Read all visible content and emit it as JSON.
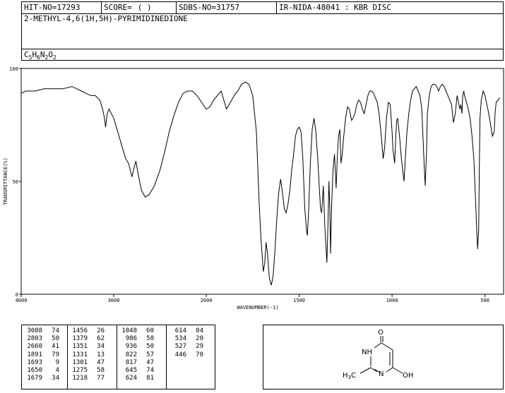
{
  "header": {
    "hit_no": "HIT-NO=17293",
    "score_label": "SCORE=",
    "score_value": "(    )",
    "sdbs_no": "SDBS-NO=31757",
    "ir_info": "IR-NIDA-48041 : KBR DISC",
    "compound_name": "2-METHYL-4,6(1H,5H)-PYRIMIDINEDIONE",
    "formula": {
      "c": "C",
      "c_n": "5",
      "h": "H",
      "h_n": "6",
      "n": "N",
      "n_n": "2",
      "o": "O",
      "o_n": "2"
    }
  },
  "chart_data": {
    "type": "line",
    "xlabel": "WAVENUMBER(-1)",
    "ylabel": "TRANSMITTANCE(%)",
    "x_ticks": [
      "4000",
      "3000",
      "2000",
      "1500",
      "1000",
      "500"
    ],
    "y_ticks": [
      "100",
      "50",
      "0"
    ],
    "xlim": [
      4000,
      400
    ],
    "ylim": [
      0,
      100
    ],
    "x_axis": "piecewise: 4000-2000 compressed, 2000-400 expanded",
    "grid": false,
    "x": [
      4000,
      3950,
      3850,
      3750,
      3650,
      3550,
      3450,
      3400,
      3350,
      3300,
      3250,
      3200,
      3150,
      3120,
      3100,
      3088,
      3070,
      3050,
      3000,
      2950,
      2900,
      2870,
      2840,
      2803,
      2780,
      2760,
      2740,
      2700,
      2660,
      2620,
      2560,
      2500,
      2450,
      2400,
      2350,
      2300,
      2250,
      2200,
      2150,
      2100,
      2050,
      2000,
      1980,
      1960,
      1940,
      1920,
      1891,
      1870,
      1850,
      1830,
      1810,
      1790,
      1770,
      1750,
      1730,
      1715,
      1705,
      1693,
      1685,
      1678,
      1670,
      1665,
      1660,
      1650,
      1640,
      1630,
      1620,
      1610,
      1600,
      1590,
      1580,
      1570,
      1560,
      1550,
      1540,
      1530,
      1520,
      1510,
      1500,
      1490,
      1480,
      1470,
      1460,
      1456,
      1450,
      1440,
      1430,
      1420,
      1410,
      1400,
      1390,
      1385,
      1379,
      1370,
      1362,
      1351,
      1345,
      1340,
      1335,
      1331,
      1325,
      1318,
      1310,
      1301,
      1295,
      1288,
      1281,
      1275,
      1268,
      1260,
      1250,
      1240,
      1230,
      1218,
      1210,
      1200,
      1190,
      1180,
      1170,
      1160,
      1150,
      1140,
      1130,
      1120,
      1110,
      1100,
      1090,
      1080,
      1070,
      1060,
      1048,
      1040,
      1030,
      1020,
      1010,
      1000,
      995,
      986,
      980,
      975,
      970,
      960,
      950,
      936,
      930,
      920,
      910,
      900,
      890,
      880,
      870,
      860,
      850,
      840,
      830,
      822,
      815,
      810,
      800,
      790,
      780,
      770,
      760,
      750,
      740,
      730,
      720,
      710,
      700,
      690,
      680,
      670,
      660,
      650,
      645,
      640,
      635,
      630,
      624,
      620,
      614,
      610,
      600,
      590,
      580,
      570,
      560,
      550,
      545,
      540,
      534,
      530,
      527,
      520,
      510,
      500,
      490,
      480,
      470,
      460,
      450,
      446,
      440,
      430,
      420,
      400
    ],
    "values": [
      89,
      90,
      90,
      91,
      91,
      91,
      92,
      91,
      90,
      89,
      88,
      88,
      86,
      82,
      78,
      74,
      80,
      82,
      78,
      71,
      64,
      60,
      58,
      52,
      56,
      59,
      54,
      46,
      43,
      44,
      48,
      55,
      63,
      72,
      79,
      85,
      89,
      90,
      90,
      88,
      85,
      82,
      83,
      86,
      88,
      90,
      82,
      85,
      88,
      90,
      93,
      94,
      93,
      88,
      72,
      40,
      24,
      10,
      14,
      23,
      18,
      12,
      7,
      4,
      8,
      20,
      34,
      45,
      51,
      45,
      38,
      36,
      40,
      46,
      55,
      62,
      70,
      73,
      74,
      72,
      60,
      38,
      28,
      26,
      35,
      58,
      73,
      78,
      72,
      60,
      45,
      38,
      36,
      48,
      30,
      14,
      30,
      50,
      38,
      18,
      40,
      55,
      62,
      47,
      60,
      70,
      73,
      58,
      62,
      70,
      78,
      83,
      82,
      77,
      78,
      80,
      84,
      86,
      85,
      82,
      80,
      84,
      88,
      90,
      90,
      89,
      87,
      85,
      80,
      72,
      60,
      65,
      78,
      85,
      84,
      72,
      64,
      58,
      70,
      77,
      78,
      70,
      60,
      50,
      58,
      72,
      80,
      86,
      90,
      91,
      92,
      90,
      88,
      82,
      62,
      48,
      62,
      80,
      88,
      92,
      93,
      93,
      92,
      90,
      92,
      93,
      92,
      90,
      88,
      86,
      84,
      76,
      80,
      88,
      86,
      84,
      82,
      84,
      80,
      88,
      90,
      88,
      85,
      82,
      78,
      70,
      60,
      40,
      30,
      20,
      28,
      60,
      78,
      86,
      90,
      88,
      84,
      80,
      75,
      70,
      72,
      80,
      85,
      86,
      87
    ]
  },
  "peaks": [
    [
      [
        "3088",
        "74"
      ],
      [
        "2803",
        "50"
      ],
      [
        "2660",
        "41"
      ],
      [
        "1891",
        "79"
      ],
      [
        "1693",
        "9"
      ],
      [
        "1650",
        "4"
      ],
      [
        "1679",
        "34"
      ]
    ],
    [
      [
        "1456",
        "26"
      ],
      [
        "1379",
        "62"
      ],
      [
        "1351",
        "34"
      ],
      [
        "1331",
        "13"
      ],
      [
        "1301",
        "47"
      ],
      [
        "1275",
        "58"
      ],
      [
        "1218",
        "77"
      ]
    ],
    [
      [
        "1048",
        "60"
      ],
      [
        "986",
        "58"
      ],
      [
        "936",
        "50"
      ],
      [
        "822",
        "57"
      ],
      [
        "817",
        "47"
      ],
      [
        "645",
        "74"
      ],
      [
        "624",
        "81"
      ]
    ],
    [
      [
        "614",
        "84"
      ],
      [
        "534",
        "20"
      ],
      [
        "527",
        "29"
      ],
      [
        "446",
        "70"
      ]
    ]
  ],
  "structure": {
    "atoms": {
      "o_top": "O",
      "nh": "NH",
      "n_ring": "N",
      "oh": "OH",
      "methyl": "H3C"
    }
  }
}
